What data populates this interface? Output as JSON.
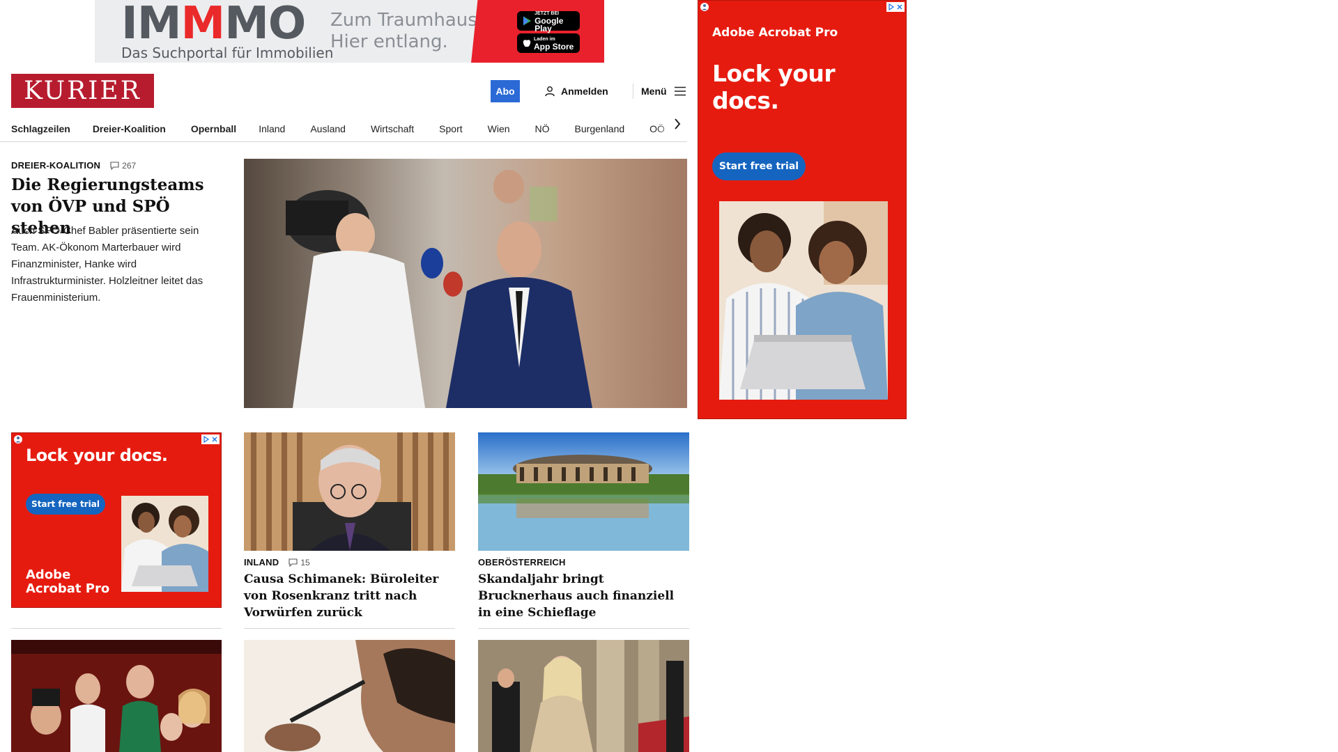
{
  "top_ad": {
    "logo_part1": "IM",
    "logo_part2": "M",
    "logo_part3": "MO",
    "subtitle": "Das Suchportal für Immobilien",
    "slogan_line1": "Zum Traumhaus?",
    "slogan_line2": "Hier entlang.",
    "google_play_small": "JETZT BEI",
    "google_play": "Google Play",
    "app_store_small": "Laden im",
    "app_store": "App Store"
  },
  "header": {
    "logo": "KURIER",
    "abo_label": "Abo",
    "login_label": "Anmelden",
    "menu_label": "Menü"
  },
  "nav": {
    "items": [
      "Schlagzeilen",
      "Dreier-Koalition",
      "Opernball",
      "Inland",
      "Ausland",
      "Wirtschaft",
      "Sport",
      "Wien",
      "NÖ",
      "Burgenland",
      "OÖ"
    ]
  },
  "lead": {
    "kicker": "DREIER-KOALITION",
    "comments": "267",
    "title": "Die Regierungsteams von ÖVP und SPÖ stehen",
    "teaser": "Auch SPÖ-Chef Babler präsentierte sein Team. AK-Ökonom Marterbauer wird Finanzminister, Hanke wird Infrastrukturminister. Holzleitner leitet das Frauenministerium."
  },
  "right_ad": {
    "brand": "Adobe Acrobat Pro",
    "headline": "Lock your docs.",
    "cta": "Start free trial"
  },
  "inline_ad": {
    "headline": "Lock your docs.",
    "cta": "Start free trial",
    "brand_line1": "Adobe",
    "brand_line2": "Acrobat Pro"
  },
  "cards": [
    {
      "kicker": "INLAND",
      "comments": "15",
      "title": "Causa Schimanek: Büroleiter von Rosenkranz tritt nach Vorwürfen zurück"
    },
    {
      "kicker": "OBERÖSTERREICH",
      "title": "Skandaljahr bringt Brucknerhaus auch finanziell in eine Schieflage"
    }
  ],
  "colors": {
    "kurier_red": "#b71c2e",
    "abo_blue": "#2b6ad6",
    "ad_red": "#e61b0f",
    "ad_cta_blue": "#1565c0"
  }
}
